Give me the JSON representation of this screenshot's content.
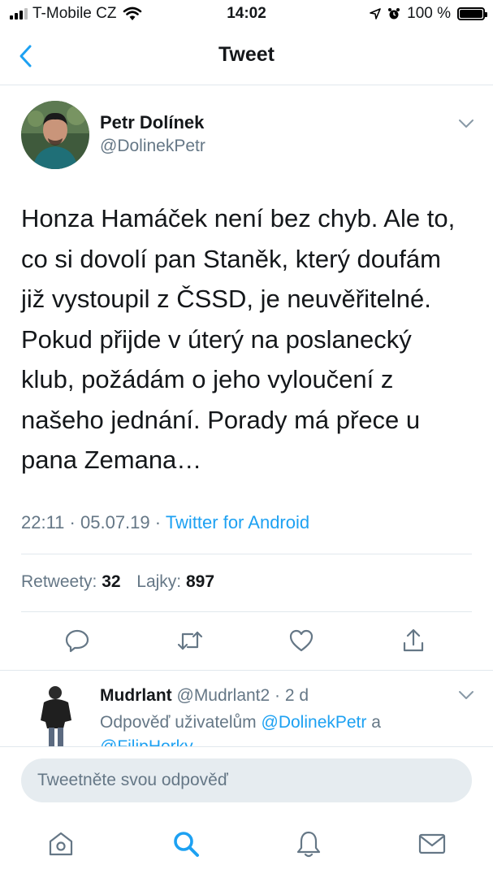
{
  "status_bar": {
    "carrier": "T-Mobile CZ",
    "time": "14:02",
    "battery_percent": "100 %",
    "battery_level": 1.0
  },
  "nav": {
    "title": "Tweet",
    "back_icon": "chevron-left-icon"
  },
  "tweet": {
    "author_name": "Petr Dolínek",
    "author_handle": "@DolinekPetr",
    "text": "Honza Hamáček není bez chyb. Ale to,\nco si dovolí pan Staněk, který doufám\njiž vystoupil z ČSSD, je neuvěřitelné.\nPokud přijde v úterý na poslanecký\nklub, požádám o jeho vyloučení z\nnašeho jednání. Porady má přece u\npana Zemana…",
    "time": "22:11",
    "date": "05.07.19",
    "client": "Twitter for Android",
    "retweets_label": "Retweety:",
    "retweets_count": "32",
    "likes_label": "Lajky:",
    "likes_count": "897"
  },
  "reply": {
    "name": "Mudrlant",
    "handle": "@Mudrlant2",
    "age": "2 d",
    "reply_prefix": "Odpověď uživatelům",
    "mention_1": "@DolinekPetr",
    "conjunction": "a",
    "mention_2": "@FilipHorky"
  },
  "composer": {
    "placeholder": "Tweetněte svou odpověď"
  },
  "colors": {
    "accent": "#1da1f2",
    "secondary_text": "#657786",
    "divider": "#e1e8ed"
  }
}
